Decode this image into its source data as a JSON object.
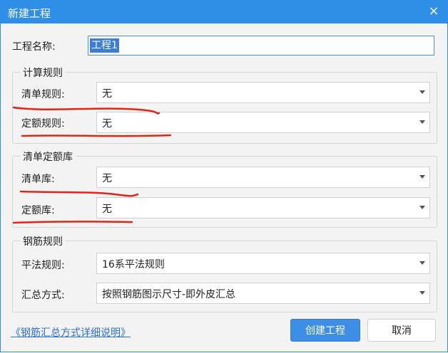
{
  "dialog": {
    "title": "新建工程",
    "close_label": "×"
  },
  "project_name": {
    "label": "工程名称:",
    "value": "工程1"
  },
  "calc_rules": {
    "title": "计算规则",
    "bill_rule": {
      "label": "清单规则:",
      "value": "无"
    },
    "quota_rule": {
      "label": "定额规则:",
      "value": "无"
    }
  },
  "library": {
    "title": "清单定额库",
    "bill_lib": {
      "label": "清单库:",
      "value": "无"
    },
    "quota_lib": {
      "label": "定额库:",
      "value": "无"
    }
  },
  "rebar": {
    "title": "钢筋规则",
    "flat_rule": {
      "label": "平法规则:",
      "value": "16系平法规则"
    },
    "summary_mode": {
      "label": "汇总方式:",
      "value": "按照钢筋图示尺寸-即外皮汇总"
    }
  },
  "footer": {
    "help_link": "《钢筋汇总方式详细说明》",
    "create_button": "创建工程",
    "cancel_button": "取消"
  },
  "annotation_color": "#e2231a"
}
